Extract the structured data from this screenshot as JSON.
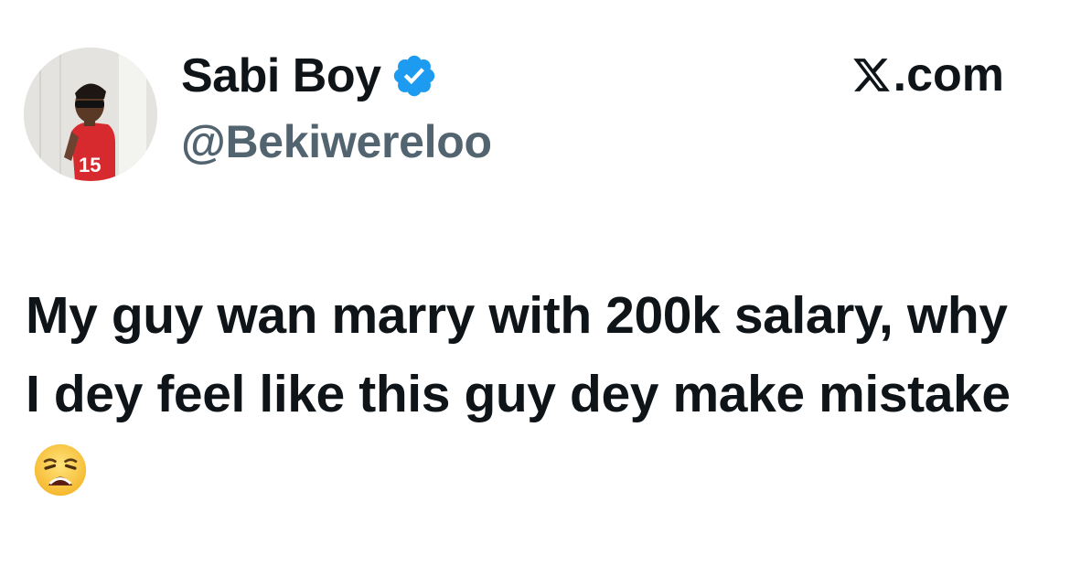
{
  "header": {
    "display_name": "Sabi Boy",
    "handle": "@Bekiwereloo",
    "site": ".com",
    "site_logo": "x-logo",
    "verified_icon": "verified-badge-icon"
  },
  "tweet": {
    "text": "My guy wan marry with 200k salary, why I dey feel like this guy dey make mistake",
    "emoji": "weary-face-emoji"
  },
  "colors": {
    "name": "#0f1419",
    "handle": "#536471",
    "verified": "#1d9bf0",
    "background": "#ffffff"
  }
}
